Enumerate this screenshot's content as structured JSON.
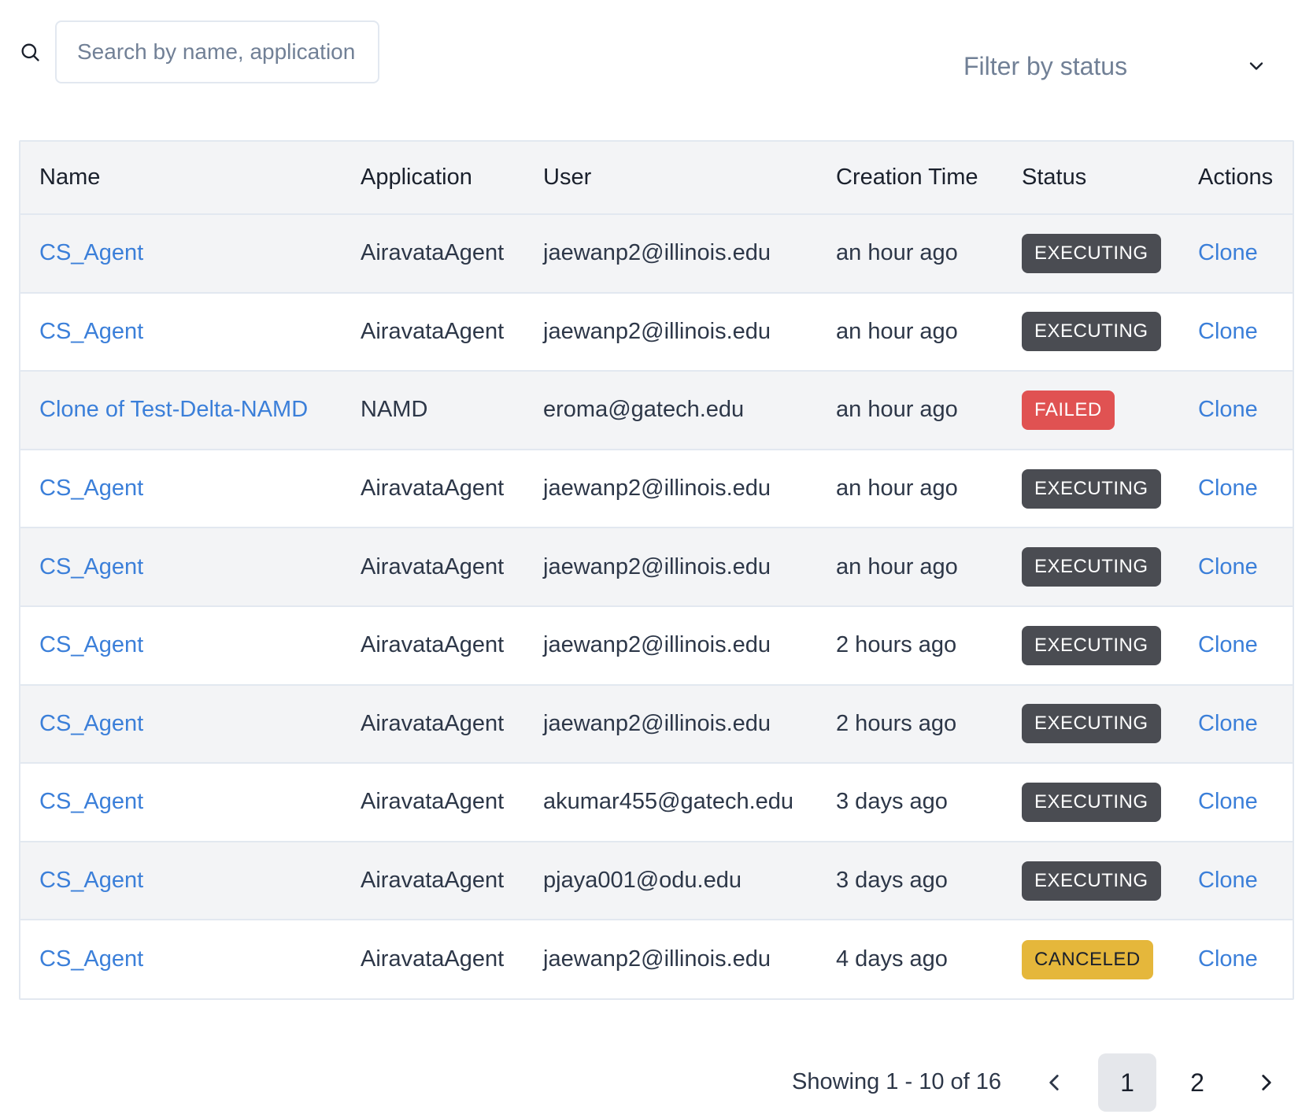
{
  "search": {
    "placeholder": "Search by name, application, or user",
    "value": ""
  },
  "status_filter": {
    "label": "Filter by status"
  },
  "table": {
    "columns": [
      "Name",
      "Application",
      "User",
      "Creation Time",
      "Status",
      "Actions"
    ],
    "rows": [
      {
        "name": "CS_Agent",
        "application": "AiravataAgent",
        "user": "jaewanp2@illinois.edu",
        "time": "an hour ago",
        "status": "EXECUTING",
        "action": "Clone"
      },
      {
        "name": "CS_Agent",
        "application": "AiravataAgent",
        "user": "jaewanp2@illinois.edu",
        "time": "an hour ago",
        "status": "EXECUTING",
        "action": "Clone"
      },
      {
        "name": "Clone of Test-Delta-NAMD",
        "application": "NAMD",
        "user": "eroma@gatech.edu",
        "time": "an hour ago",
        "status": "FAILED",
        "action": "Clone"
      },
      {
        "name": "CS_Agent",
        "application": "AiravataAgent",
        "user": "jaewanp2@illinois.edu",
        "time": "an hour ago",
        "status": "EXECUTING",
        "action": "Clone"
      },
      {
        "name": "CS_Agent",
        "application": "AiravataAgent",
        "user": "jaewanp2@illinois.edu",
        "time": "an hour ago",
        "status": "EXECUTING",
        "action": "Clone"
      },
      {
        "name": "CS_Agent",
        "application": "AiravataAgent",
        "user": "jaewanp2@illinois.edu",
        "time": "2 hours ago",
        "status": "EXECUTING",
        "action": "Clone"
      },
      {
        "name": "CS_Agent",
        "application": "AiravataAgent",
        "user": "jaewanp2@illinois.edu",
        "time": "2 hours ago",
        "status": "EXECUTING",
        "action": "Clone"
      },
      {
        "name": "CS_Agent",
        "application": "AiravataAgent",
        "user": "akumar455@gatech.edu",
        "time": "3 days ago",
        "status": "EXECUTING",
        "action": "Clone"
      },
      {
        "name": "CS_Agent",
        "application": "AiravataAgent",
        "user": "pjaya001@odu.edu",
        "time": "3 days ago",
        "status": "EXECUTING",
        "action": "Clone"
      },
      {
        "name": "CS_Agent",
        "application": "AiravataAgent",
        "user": "jaewanp2@illinois.edu",
        "time": "4 days ago",
        "status": "CANCELED",
        "action": "Clone"
      }
    ]
  },
  "pagination": {
    "showing": "Showing 1 - 10 of 16",
    "pages": [
      "1",
      "2"
    ],
    "current_page": "1"
  },
  "colors": {
    "link": "#3b7fd9",
    "executing": "#4a4c52",
    "failed": "#e05252",
    "canceled": "#e5b73b"
  },
  "icons": {
    "search": "search-icon",
    "dropdown": "chevron-down-icon",
    "prev": "chevron-left-icon",
    "next": "chevron-right-icon"
  }
}
